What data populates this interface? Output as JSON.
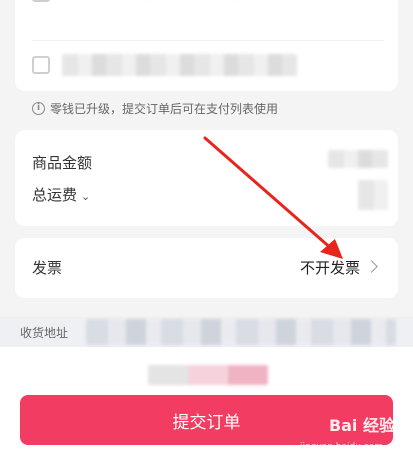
{
  "notice": {
    "icon": "info-icon",
    "text": "零钱已升级，提交订单后可在支付列表使用"
  },
  "amount": {
    "goods_label": "商品金额",
    "shipping_label": "总运费"
  },
  "invoice": {
    "label": "发票",
    "value": "不开发票"
  },
  "address": {
    "label": "收货地址"
  },
  "submit": {
    "label": "提交订单",
    "color": "#f23c61"
  },
  "annotation": {
    "arrow_color": "#e8241b"
  },
  "watermark": {
    "brand": "Bai 经验",
    "url": "jingyan.baidu.com"
  }
}
